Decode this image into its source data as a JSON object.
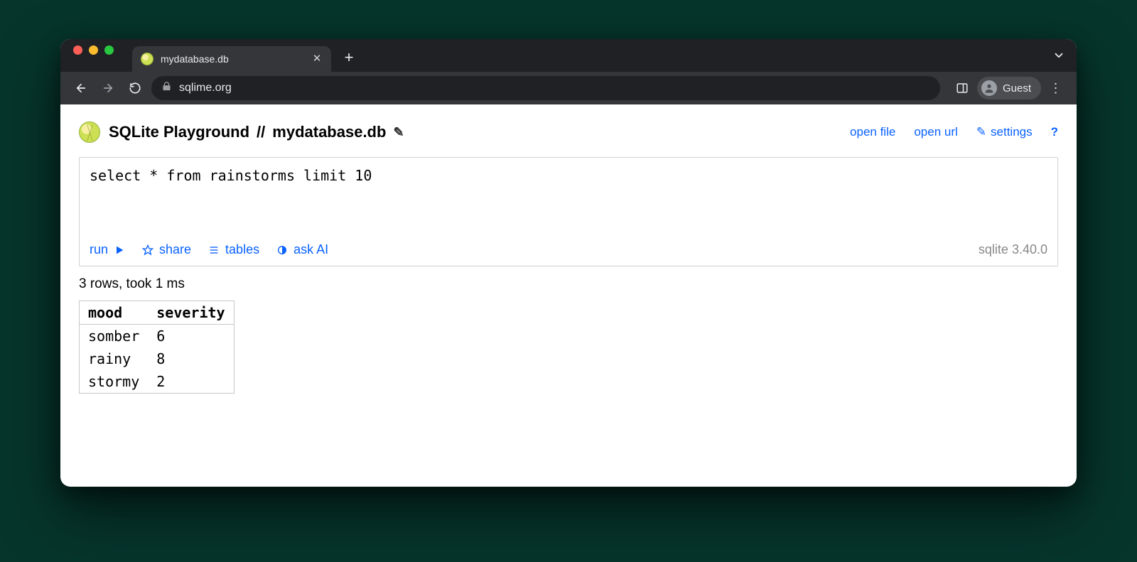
{
  "browser": {
    "tab_title": "mydatabase.db",
    "url_display": "sqlime.org",
    "guest_label": "Guest"
  },
  "header": {
    "app_title": "SQLite Playground",
    "separator": "//",
    "db_name": "mydatabase.db",
    "actions": {
      "open_file": "open file",
      "open_url": "open url",
      "settings": "settings",
      "help": "?"
    }
  },
  "editor": {
    "sql": "select * from rainstorms limit 10",
    "actions": {
      "run": "run",
      "share": "share",
      "tables": "tables",
      "ask_ai": "ask AI"
    },
    "version": "sqlite 3.40.0"
  },
  "results": {
    "status": "3 rows, took 1 ms",
    "columns": [
      "mood",
      "severity"
    ],
    "rows": [
      {
        "mood": "somber",
        "severity": "6"
      },
      {
        "mood": "rainy",
        "severity": "8"
      },
      {
        "mood": "stormy",
        "severity": "2"
      }
    ]
  }
}
